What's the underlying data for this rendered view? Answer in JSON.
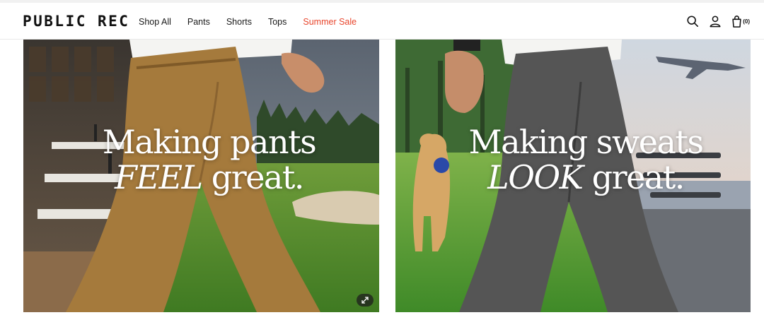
{
  "brand": {
    "logo_text": "PUBLIC REC"
  },
  "nav": {
    "items": [
      {
        "label": "Shop All"
      },
      {
        "label": "Pants"
      },
      {
        "label": "Shorts"
      },
      {
        "label": "Tops"
      },
      {
        "label": "Summer Sale",
        "color": "#e8452c"
      }
    ]
  },
  "header_icons": {
    "search": "search-icon",
    "account": "user-icon",
    "cart": "bag-icon",
    "cart_count": "(0)"
  },
  "hero": [
    {
      "line1": "Making pants",
      "line2_emphasis": "FEEL",
      "line2_rest": " great.",
      "scene": "golf-course-office",
      "pants_color": "#a57a3c"
    },
    {
      "line1": "Making sweats",
      "line2_emphasis": "LOOK",
      "line2_rest": " great.",
      "scene": "park-airport",
      "pants_color": "#555555"
    }
  ],
  "expand_icon": "expand-arrows-icon"
}
